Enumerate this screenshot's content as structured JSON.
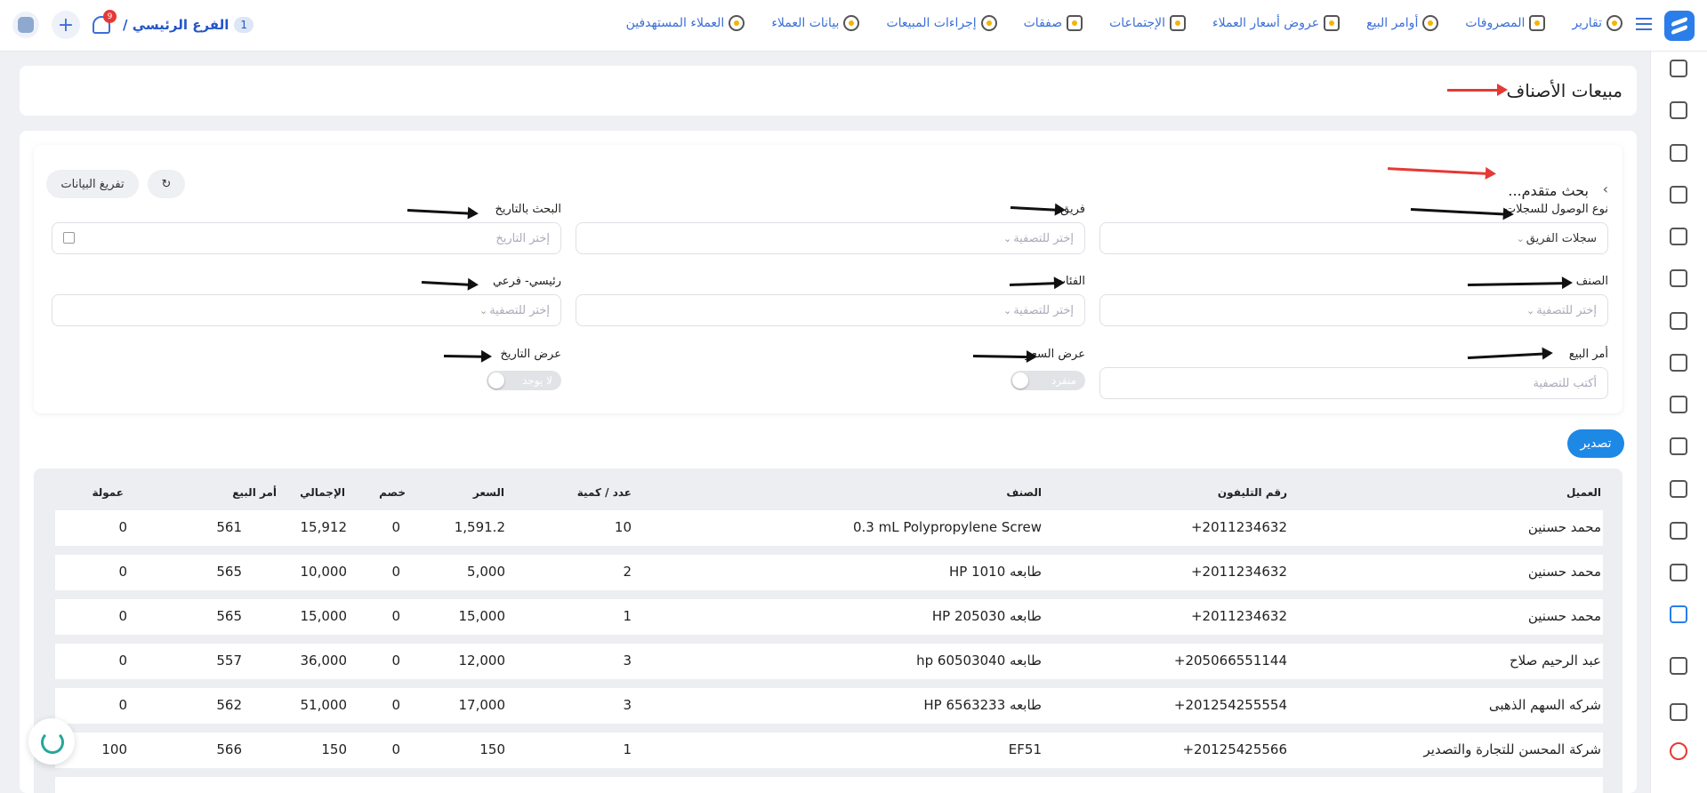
{
  "topbar": {
    "nav": [
      {
        "label": "العملاء المستهدفين",
        "icon": "target-users-icon"
      },
      {
        "label": "بيانات العملاء",
        "icon": "customer-data-icon"
      },
      {
        "label": "إجراءات المبيعات",
        "icon": "sales-actions-icon"
      },
      {
        "label": "صفقات",
        "icon": "deals-icon"
      },
      {
        "label": "الإجتماعات",
        "icon": "meetings-icon"
      },
      {
        "label": "عروض أسعار العملاء",
        "icon": "quotes-icon"
      },
      {
        "label": "أوامر البيع",
        "icon": "sales-orders-icon"
      },
      {
        "label": "المصروفات",
        "icon": "expenses-icon"
      },
      {
        "label": "تقارير",
        "icon": "reports-icon"
      }
    ],
    "branch_name": "الفرع الرئيسي /",
    "branch_count": "1",
    "notification_count": "9",
    "add_label": "+"
  },
  "page": {
    "title": "مبيعات الأصناف"
  },
  "search": {
    "title": "بحث متقدم...",
    "clear_button": "تفريغ البيانات",
    "fields": {
      "access_type": {
        "label": "نوع الوصول للسجلات",
        "value": "سجلات الفريق"
      },
      "team": {
        "label": "فريق",
        "placeholder": "إختر للتصفية"
      },
      "date_search": {
        "label": "البحث بالتاريخ",
        "placeholder": "إختر التاريخ"
      },
      "item": {
        "label": "الصنف",
        "placeholder": "إختر للتصفية"
      },
      "categories": {
        "label": "الفئات",
        "placeholder": "إختر للتصفية"
      },
      "main_sub": {
        "label": "رئيسي- فرعي",
        "placeholder": "إختر للتصفية"
      },
      "sales_order": {
        "label": "أمر البيع",
        "placeholder": "أكتب للتصفية"
      },
      "price_view": {
        "label": "عرض السعر",
        "toggle_text": "منفرد"
      },
      "date_view": {
        "label": "عرض التاريخ",
        "toggle_text": "لا يوجد"
      }
    }
  },
  "export_button": "تصدير",
  "table": {
    "headers": {
      "customer": "العميل",
      "phone": "رقم التليفون",
      "item": "الصنف",
      "qty": "عدد / كمية",
      "price": "السعر",
      "discount": "خصم",
      "total": "الإجمالي",
      "order": "أمر البيع",
      "commission": "عمولة"
    },
    "rows": [
      {
        "customer": "محمد حسنين",
        "phone": "+2011234632",
        "item": "0.3 mL Polypropylene Screw",
        "qty": "10",
        "price": "1,591.2",
        "discount": "0",
        "total": "15,912",
        "order": "561",
        "commission": "0"
      },
      {
        "customer": "محمد حسنين",
        "phone": "+2011234632",
        "item": "طابعه HP 1010",
        "qty": "2",
        "price": "5,000",
        "discount": "0",
        "total": "10,000",
        "order": "565",
        "commission": "0"
      },
      {
        "customer": "محمد حسنين",
        "phone": "+2011234632",
        "item": "طابعه HP 205030",
        "qty": "1",
        "price": "15,000",
        "discount": "0",
        "total": "15,000",
        "order": "565",
        "commission": "0"
      },
      {
        "customer": "عبد الرحيم صلاح",
        "phone": "+205066551144",
        "item": "طابعه hp 60503040",
        "qty": "3",
        "price": "12,000",
        "discount": "0",
        "total": "36,000",
        "order": "557",
        "commission": "0"
      },
      {
        "customer": "شركه السهم الذهبى",
        "phone": "+201254255554",
        "item": "طابعه HP 6563233",
        "qty": "3",
        "price": "17,000",
        "discount": "0",
        "total": "51,000",
        "order": "562",
        "commission": "0"
      },
      {
        "customer": "شركة المحسن للتجارة والتصدير",
        "phone": "+20125425566",
        "item": "EF51",
        "qty": "1",
        "price": "150",
        "discount": "0",
        "total": "150",
        "order": "566",
        "commission": "100"
      }
    ]
  },
  "colors": {
    "accent": "#2b7de9",
    "export": "#1e88e5",
    "red_arrow": "#e53935"
  }
}
